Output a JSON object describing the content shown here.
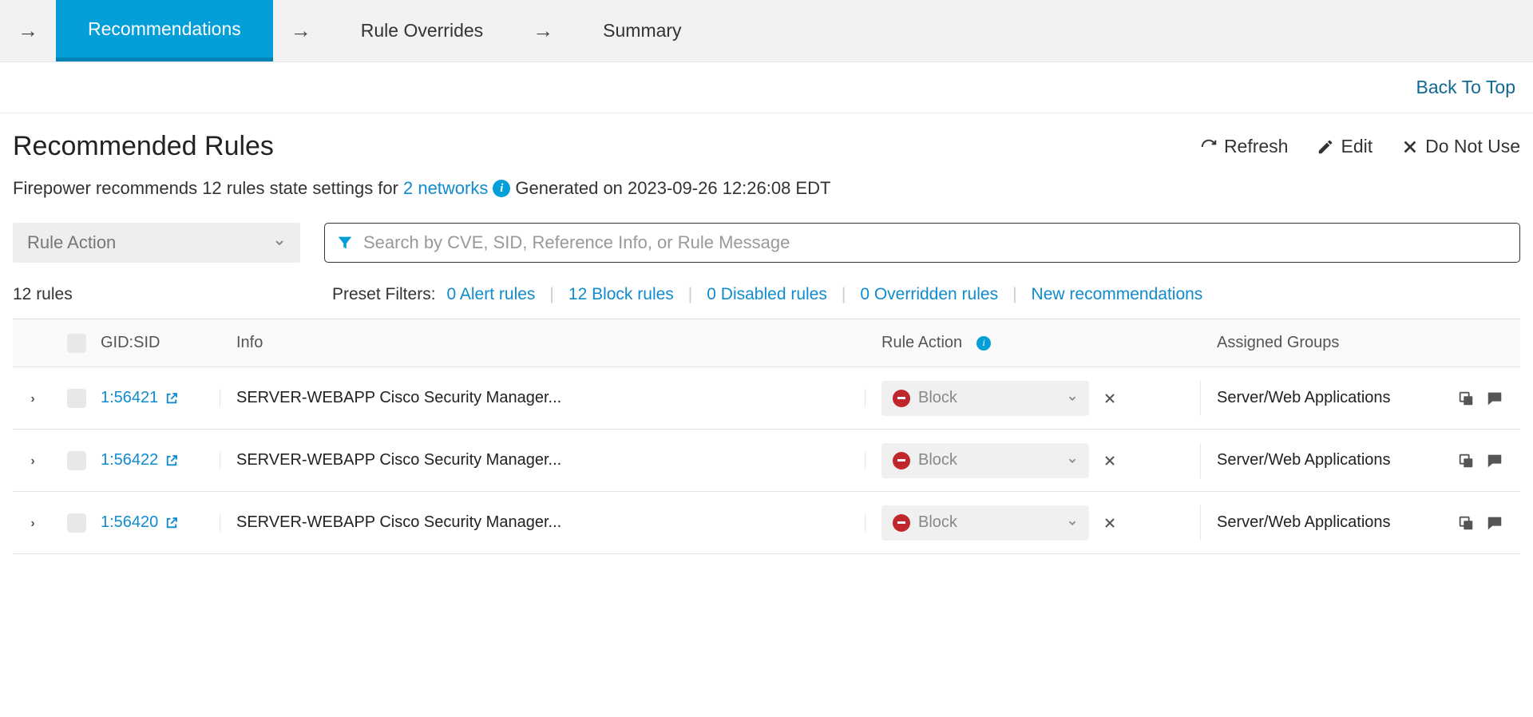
{
  "tabs": {
    "recommendations": "Recommendations",
    "rule_overrides": "Rule Overrides",
    "summary": "Summary"
  },
  "back_to_top": "Back To Top",
  "page_title": "Recommended Rules",
  "actions": {
    "refresh": "Refresh",
    "edit": "Edit",
    "do_not_use": "Do Not Use"
  },
  "subtext": {
    "prefix": "Firepower recommends 12 rules state settings for",
    "networks": "2 networks",
    "generated": "Generated on 2023-09-26 12:26:08 EDT"
  },
  "rule_action_dd": "Rule Action",
  "search_placeholder": "Search by CVE, SID, Reference Info, or Rule Message",
  "rule_count": "12 rules",
  "preset_label": "Preset Filters:",
  "presets": {
    "alert": "0 Alert rules",
    "block": "12 Block rules",
    "disabled": "0 Disabled rules",
    "overridden": "0 Overridden rules",
    "new": "New recommendations"
  },
  "columns": {
    "gid": "GID:SID",
    "info": "Info",
    "action": "Rule Action",
    "groups": "Assigned Groups"
  },
  "rows": [
    {
      "gid": "1:56421",
      "info": "SERVER-WEBAPP Cisco Security Manager...",
      "action": "Block",
      "groups": "Server/Web Applications"
    },
    {
      "gid": "1:56422",
      "info": "SERVER-WEBAPP Cisco Security Manager...",
      "action": "Block",
      "groups": "Server/Web Applications"
    },
    {
      "gid": "1:56420",
      "info": "SERVER-WEBAPP Cisco Security Manager...",
      "action": "Block",
      "groups": "Server/Web Applications"
    }
  ]
}
